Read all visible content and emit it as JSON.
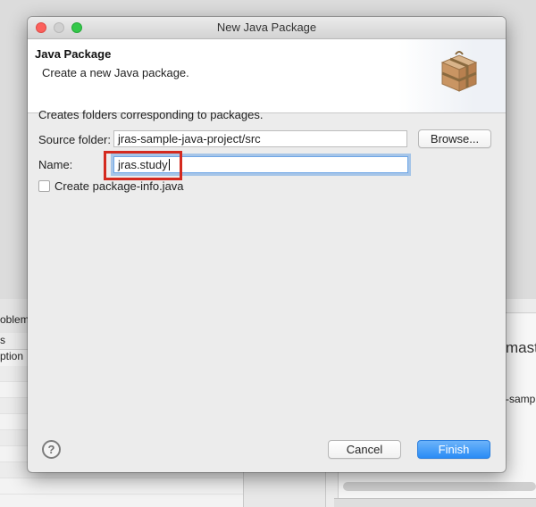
{
  "window": {
    "title": "New Java Package"
  },
  "header": {
    "title": "Java Package",
    "description": "Create a new Java package.",
    "icon": "package-box-icon"
  },
  "content": {
    "description": "Creates folders corresponding to packages.",
    "source_folder": {
      "label": "Source folder:",
      "value": "jras-sample-java-project/src",
      "browse_label": "Browse..."
    },
    "name": {
      "label": "Name:",
      "value": "jras.study"
    },
    "package_info": {
      "label": "Create package-info.java",
      "checked": false
    }
  },
  "footer": {
    "help_symbol": "?",
    "cancel_label": "Cancel",
    "finish_label": "Finish"
  },
  "background": {
    "left_tab": "oblem",
    "left_header": "s",
    "left_col": "ption",
    "right_title": "maste",
    "right_branch": "-samp"
  },
  "colors": {
    "highlight_annotation": "#d42a1f",
    "focus_ring": "#6ea6e6",
    "primary_button": "#2a8cf5"
  }
}
